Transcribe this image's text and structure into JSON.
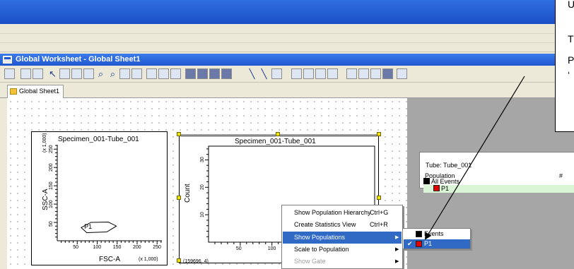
{
  "worksheet": {
    "title": "Global Worksheet - Global Sheet1",
    "tab_label": "Global Sheet1"
  },
  "plots": {
    "dot": {
      "title": "Specimen_001-Tube_001",
      "xlabel": "FSC-A",
      "ylabel": "SSC-A",
      "x_scale_note": "(x 1,000)",
      "y_scale_note": "(x 1,000)",
      "x_ticks": [
        "50",
        "100",
        "150",
        "200",
        "250"
      ],
      "y_ticks": [
        "50",
        "100",
        "150",
        "200",
        "250"
      ],
      "gate_label": "P1"
    },
    "histogram": {
      "title": "Specimen_001-Tube_001",
      "ylabel": "Count",
      "x_ticks": [
        "50",
        "100"
      ],
      "y_ticks": [
        "10",
        "20",
        "30"
      ],
      "coord_readout": "(159696, 4)"
    }
  },
  "chart_data": [
    {
      "type": "scatter",
      "title": "Specimen_001-Tube_001",
      "xlabel": "FSC-A",
      "ylabel": "SSC-A",
      "xlim": [
        0,
        262
      ],
      "ylim": [
        0,
        262
      ],
      "x_ticks": [
        50,
        100,
        150,
        200,
        250
      ],
      "y_ticks": [
        50,
        100,
        150,
        200,
        250
      ],
      "gates": [
        {
          "name": "P1",
          "polygon": [
            [
              60,
              36
            ],
            [
              84,
              50
            ],
            [
              128,
              51
            ],
            [
              148,
              40
            ],
            [
              124,
              24
            ],
            [
              74,
              22
            ]
          ]
        }
      ]
    },
    {
      "type": "bar",
      "title": "Specimen_001-Tube_001",
      "ylabel": "Count",
      "xlim": [
        0,
        262
      ],
      "ylim": [
        0,
        35
      ],
      "x_ticks": [
        50,
        100
      ],
      "y_ticks": [
        10,
        20,
        30
      ]
    }
  ],
  "population_view": {
    "tube_label": "Tube:",
    "tube_value": "Tube_001",
    "column_header": "Population",
    "hash_header": "#",
    "rows": [
      {
        "label": "All Events",
        "color": "#000000"
      },
      {
        "label": "P1",
        "color": "#e00000"
      }
    ]
  },
  "context_menu": {
    "items": [
      {
        "label": "Show Population Hierarchy",
        "shortcut": "Ctrl+G"
      },
      {
        "label": "Create Statistics View",
        "shortcut": "Ctrl+R"
      },
      {
        "label": "Show Populations",
        "shortcut": ""
      },
      {
        "label": "Scale to Population",
        "shortcut": ""
      },
      {
        "label": "Show Gate",
        "shortcut": ""
      }
    ]
  },
  "submenu": {
    "items": [
      {
        "label": "Events",
        "color": "#000000",
        "checked": false
      },
      {
        "label": "P1",
        "color": "#e00000",
        "checked": true
      }
    ]
  },
  "callout": {
    "lines": [
      "U",
      "T",
      "P",
      "‘"
    ]
  },
  "colors": {
    "titlebar": "#1f56cf",
    "menu_highlight": "#316ac5",
    "handle": "#f2e400",
    "population_all": "#000000",
    "population_p1": "#e00000"
  }
}
